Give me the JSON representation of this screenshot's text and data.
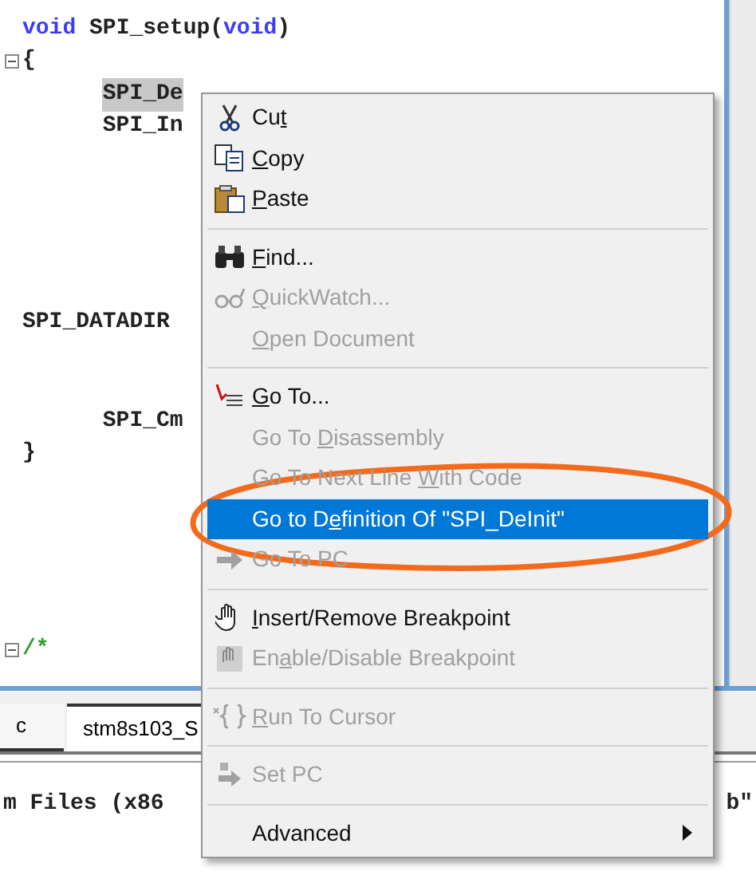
{
  "editor": {
    "lines": [
      {
        "segments": [
          {
            "text": "void",
            "kind": "keyword"
          },
          {
            "text": " SPI_setup(",
            "kind": "plain"
          },
          {
            "text": "void",
            "kind": "keyword"
          },
          {
            "text": ")",
            "kind": "plain"
          }
        ],
        "selected": false,
        "fold": false
      },
      {
        "segments": [
          {
            "text": "{",
            "kind": "plain"
          }
        ],
        "selected": false,
        "fold": true
      },
      {
        "segments": [
          {
            "text": "SPI_De",
            "kind": "plain"
          }
        ],
        "selected": true,
        "fold": false
      },
      {
        "segments": [
          {
            "text": "SPI_In",
            "kind": "plain"
          }
        ],
        "selected": false,
        "fold": false
      },
      {
        "segments": [
          {
            "text": "SPI_DATADIR",
            "kind": "plain"
          }
        ],
        "selected": false,
        "fold": false
      },
      {
        "segments": [
          {
            "text": "SPI_Cm",
            "kind": "plain"
          }
        ],
        "selected": false,
        "fold": false
      },
      {
        "segments": [
          {
            "text": "}",
            "kind": "plain"
          }
        ],
        "selected": false,
        "fold": false
      },
      {
        "segments": [
          {
            "text": "/*",
            "kind": "comment"
          }
        ],
        "selected": false,
        "fold": true
      }
    ]
  },
  "tabs": [
    {
      "label": "c",
      "selected": false
    },
    {
      "label": "stm8s103_S",
      "selected": true
    }
  ],
  "output": {
    "line_start": "m Files (x86",
    "line_end": "b\""
  },
  "context_menu": {
    "groups": [
      [
        {
          "pre": "Cu",
          "key": "t",
          "disabled": false,
          "selected": false
        },
        {
          "key": "C",
          "post": "opy",
          "disabled": false,
          "selected": false
        },
        {
          "key": "P",
          "post": "aste",
          "disabled": false,
          "selected": false
        }
      ],
      [
        {
          "key": "F",
          "post": "ind...",
          "disabled": false,
          "selected": false
        },
        {
          "key": "Q",
          "post": "uickWatch...",
          "disabled": true,
          "selected": false
        },
        {
          "key": "O",
          "post": "pen Document",
          "disabled": true,
          "selected": false
        }
      ],
      [
        {
          "key": "G",
          "post": "o To...",
          "disabled": false,
          "selected": false
        },
        {
          "pre": "Go To ",
          "key": "D",
          "post": "isassembly",
          "disabled": true,
          "selected": false
        },
        {
          "pre": "Go To Next Line ",
          "key": "W",
          "post": "ith Code",
          "disabled": true,
          "selected": false
        },
        {
          "pre": "Go to D",
          "key": "e",
          "post": "finition Of \"SPI_DeInit\"",
          "disabled": false,
          "selected": true
        },
        {
          "pre": "Go To PC",
          "disabled": true,
          "selected": false
        }
      ],
      [
        {
          "key": "I",
          "post": "nsert/Remove Breakpoint",
          "disabled": false,
          "selected": false
        },
        {
          "pre": "En",
          "key": "a",
          "post": "ble/Disable Breakpoint",
          "disabled": true,
          "selected": false
        }
      ],
      [
        {
          "key": "R",
          "post": "un To Cursor",
          "disabled": true,
          "selected": false
        }
      ],
      [
        {
          "pre": "Set PC",
          "disabled": true,
          "selected": false
        }
      ],
      [
        {
          "pre": "Advanced",
          "disabled": false,
          "selected": false,
          "submenu": true
        }
      ]
    ]
  }
}
